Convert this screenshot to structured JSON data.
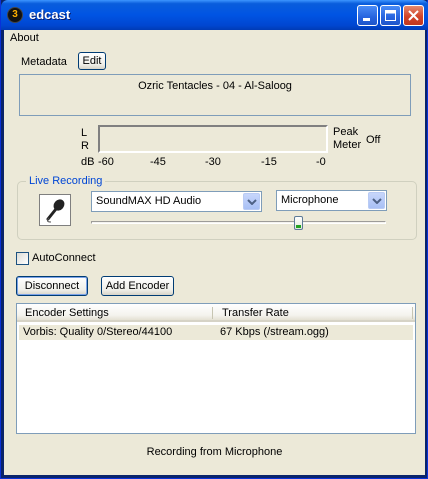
{
  "window": {
    "title": "edcast",
    "icon_glyph": "3"
  },
  "menu": {
    "items": [
      {
        "label": "About"
      }
    ]
  },
  "metadata": {
    "label": "Metadata",
    "edit_button": "Edit",
    "now_playing": "Ozric Tentacles - 04 - Al-Saloog"
  },
  "meter": {
    "channel_left": "L",
    "channel_right": "R",
    "db_label": "dB",
    "ticks": [
      "-60",
      "-45",
      "-30",
      "-15",
      "-0"
    ],
    "peak_label_line1": "Peak",
    "peak_label_line2": "Meter",
    "peak_state": "Off"
  },
  "live_recording": {
    "title": "Live Recording",
    "device": "SoundMAX HD Audio",
    "input": "Microphone",
    "volume_fraction": 0.71
  },
  "autoconnect": {
    "label": "AutoConnect",
    "checked": false
  },
  "buttons": {
    "disconnect": "Disconnect",
    "add_encoder": "Add Encoder"
  },
  "encoders": {
    "columns": [
      "Encoder Settings",
      "Transfer Rate"
    ],
    "rows": [
      {
        "settings": "Vorbis: Quality 0/Stereo/44100",
        "rate": "67 Kbps (/stream.ogg)"
      }
    ]
  },
  "status": {
    "text": "Recording from Microphone"
  },
  "colors": {
    "titlebar": "#0054e3",
    "client": "#ece9d8",
    "group_title": "#0046d5",
    "close_button": "#d2452a"
  }
}
